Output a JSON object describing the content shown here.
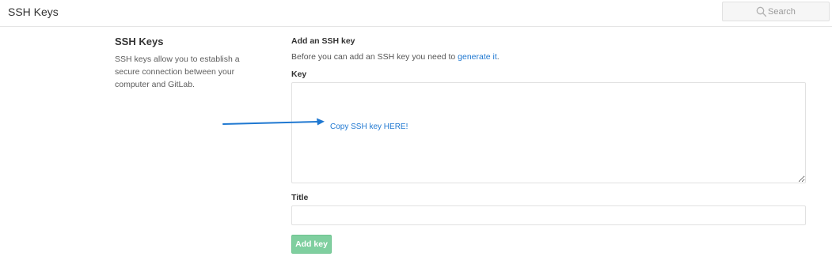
{
  "header": {
    "title": "SSH Keys",
    "search_placeholder": "Search"
  },
  "sidebar": {
    "title": "SSH Keys",
    "description": "SSH keys allow you to establish a secure connection between your computer and GitLab."
  },
  "form": {
    "heading": "Add an SSH key",
    "intro_text": "Before you can add an SSH key you need to ",
    "intro_link": "generate it",
    "intro_end": ".",
    "key_label": "Key",
    "key_value": "",
    "title_label": "Title",
    "title_value": "",
    "submit_label": "Add key"
  },
  "annotation": {
    "text": "Copy SSH key HERE!"
  },
  "colors": {
    "link": "#1f78d1",
    "submit_bg": "#7fcf9f",
    "annotation": "#1f78d1"
  },
  "icons": {
    "search": "search-icon",
    "arrow": "arrow-right-icon",
    "resize": "resize-handle-icon"
  }
}
